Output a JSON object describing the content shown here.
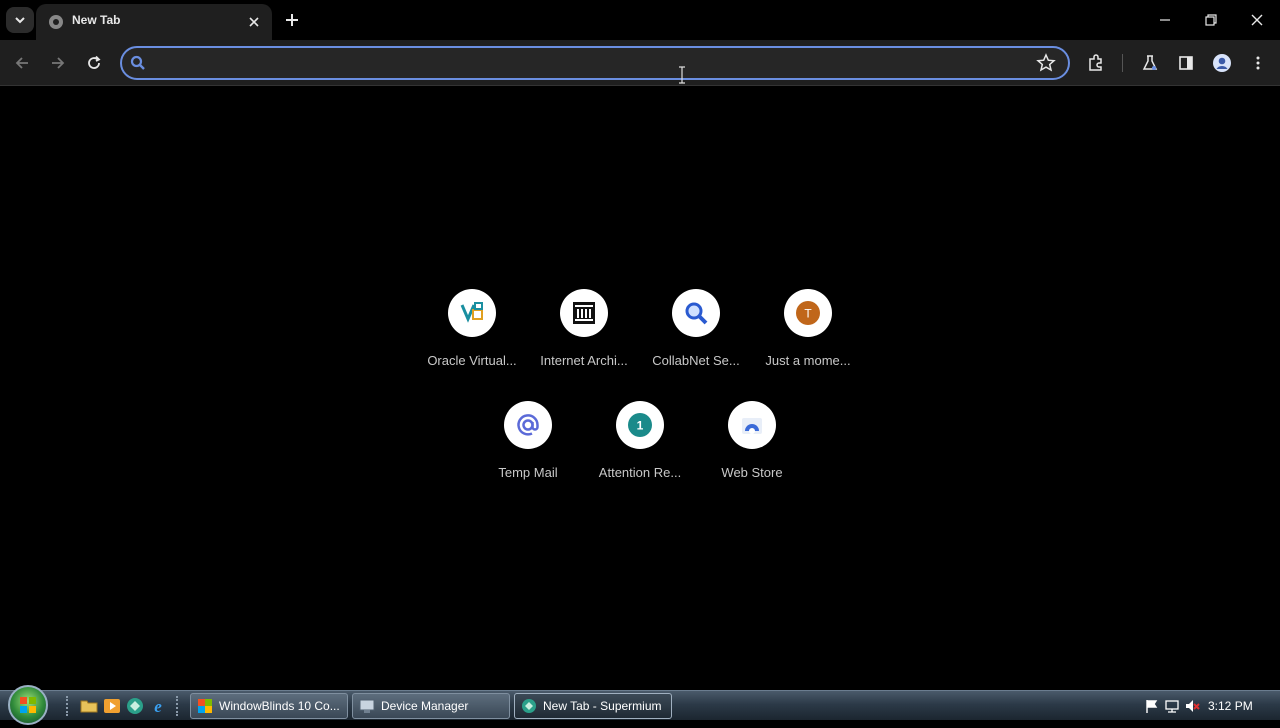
{
  "browser": {
    "tab": {
      "title": "New Tab"
    },
    "omnibox": {
      "value": "",
      "placeholder": ""
    }
  },
  "shortcuts": [
    {
      "label": "Oracle Virtual...",
      "icon": "virtualbox-icon"
    },
    {
      "label": "Internet Archi...",
      "icon": "archive-building-icon"
    },
    {
      "label": "CollabNet Se...",
      "icon": "search-icon"
    },
    {
      "label": "Just a mome...",
      "icon": "letter-avatar-icon",
      "glyph": "T",
      "color": "#c0661a"
    },
    {
      "label": "Temp Mail",
      "icon": "at-sign-icon"
    },
    {
      "label": "Attention Re...",
      "icon": "number-badge-icon",
      "glyph": "1",
      "color": "#1a8a8a"
    },
    {
      "label": "Web Store",
      "icon": "web-store-icon"
    }
  ],
  "taskbar": {
    "buttons": [
      {
        "label": "WindowBlinds 10 Co...",
        "icon": "windowblinds-icon"
      },
      {
        "label": "Device Manager",
        "icon": "device-manager-icon"
      },
      {
        "label": "New Tab - Supermium",
        "icon": "supermium-icon"
      }
    ],
    "clock": "3:12 PM"
  },
  "colors": {
    "accent": "#6a8ee0",
    "page_background": "#000000",
    "toolbar": "#1f1f1f"
  }
}
